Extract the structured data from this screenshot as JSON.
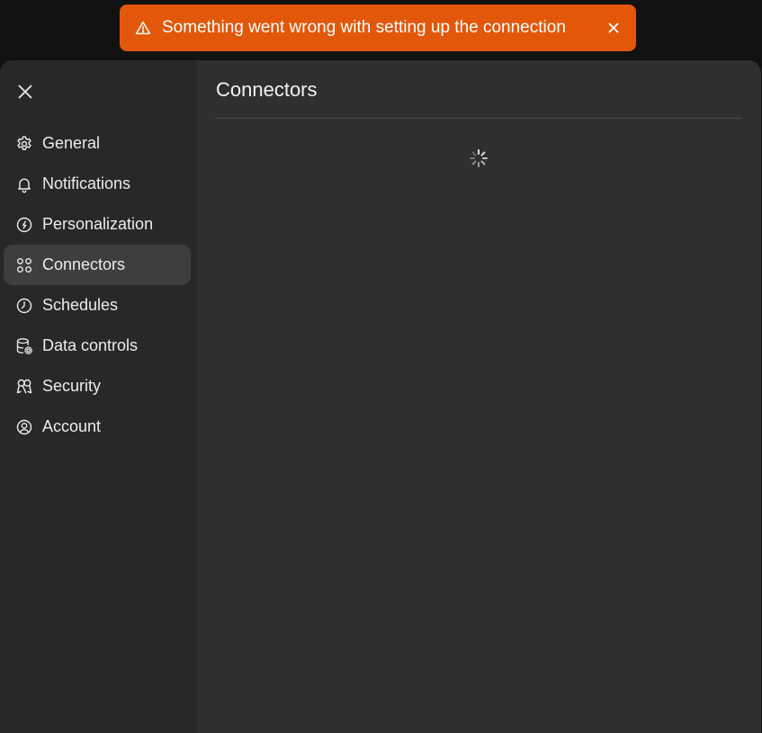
{
  "toast": {
    "message": "Something went wrong with setting up the connection",
    "icon": "warning-triangle-icon",
    "close_icon": "close-icon",
    "color": "#e2570a"
  },
  "settings": {
    "close_icon": "close-icon",
    "nav": [
      {
        "id": "general",
        "label": "General",
        "icon": "gear-icon"
      },
      {
        "id": "notifications",
        "label": "Notifications",
        "icon": "bell-icon"
      },
      {
        "id": "personalization",
        "label": "Personalization",
        "icon": "personalization-icon"
      },
      {
        "id": "connectors",
        "label": "Connectors",
        "icon": "connectors-icon",
        "active": true
      },
      {
        "id": "schedules",
        "label": "Schedules",
        "icon": "clock-icon"
      },
      {
        "id": "data-controls",
        "label": "Data controls",
        "icon": "database-gear-icon"
      },
      {
        "id": "security",
        "label": "Security",
        "icon": "security-icon"
      },
      {
        "id": "account",
        "label": "Account",
        "icon": "account-icon"
      }
    ]
  },
  "main": {
    "title": "Connectors",
    "loading_icon": "spinner-icon"
  }
}
